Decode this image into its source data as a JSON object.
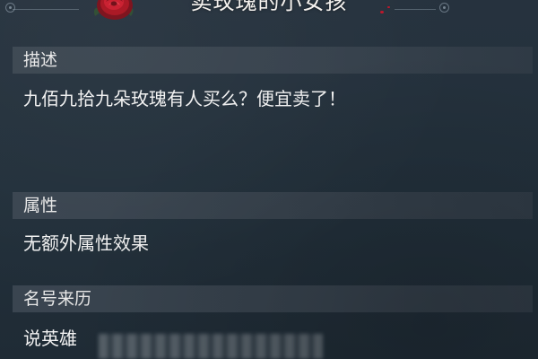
{
  "dialog": {
    "title": "卖玫瑰的小女孩"
  },
  "sections": {
    "description": {
      "header": "描述",
      "text": "九佰九拾九朵玫瑰有人买么？便宜卖了！"
    },
    "attributes": {
      "header": "属性",
      "text": "无额外属性效果"
    },
    "origin": {
      "header": "名号来历",
      "text": "说英雄"
    }
  },
  "colors": {
    "panel_background": "#23303c",
    "section_header": "#3a4550",
    "text": "#f2f2f2",
    "rose": "#c0152a"
  },
  "icons": {
    "title_decoration": "rose-icon"
  }
}
